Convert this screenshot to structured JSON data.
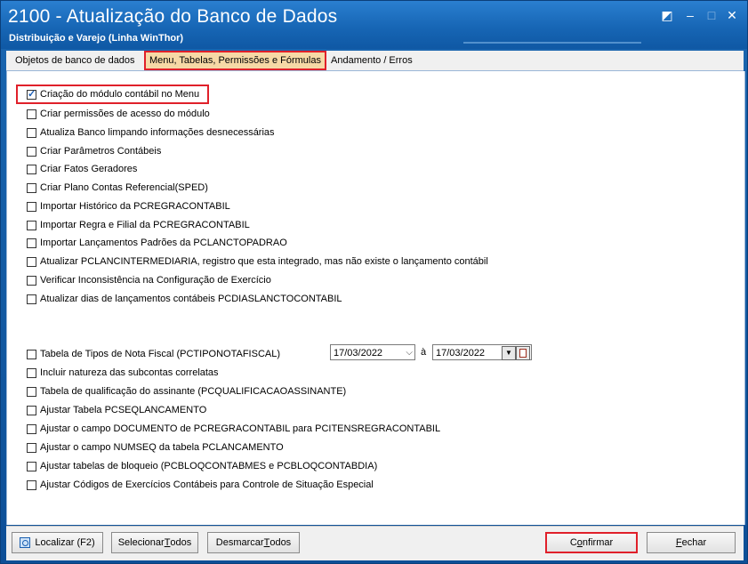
{
  "window": {
    "title": "2100 - Atualização do Banco de Dados",
    "subtitle": "Distribuição e Varejo (Linha WinThor)"
  },
  "tabs": [
    {
      "label": "Objetos de banco de dados"
    },
    {
      "label": "Menu, Tabelas, Permissões e Fórmulas"
    },
    {
      "label": "Andamento / Erros"
    }
  ],
  "options_top": [
    {
      "label": "Criação do módulo contábil no Menu",
      "checked": true
    },
    {
      "label": "Criar permissões de acesso do módulo",
      "checked": false
    },
    {
      "label": "Atualiza Banco limpando informações desnecessárias",
      "checked": false
    },
    {
      "label": "Criar Parâmetros Contábeis",
      "checked": false
    },
    {
      "label": "Criar Fatos Geradores",
      "checked": false
    },
    {
      "label": "Criar Plano Contas Referencial(SPED)",
      "checked": false
    },
    {
      "label": "Importar Histórico da PCREGRACONTABIL",
      "checked": false
    },
    {
      "label": "Importar Regra e Filial da PCREGRACONTABIL",
      "checked": false
    },
    {
      "label": "Importar Lançamentos Padrões da PCLANCTOPADRAO",
      "checked": false
    },
    {
      "label": "Atualizar PCLANCINTERMEDIARIA, registro que esta integrado, mas não existe o lançamento contábil",
      "checked": false
    },
    {
      "label": "Verificar Inconsistência na Configuração de Exercício",
      "checked": false
    },
    {
      "label": "Atualizar dias de lançamentos contábeis PCDIASLANCTOCONTABIL",
      "checked": false
    }
  ],
  "options_bottom": [
    {
      "label": "Tabela de Tipos de Nota Fiscal (PCTIPONOTAFISCAL)",
      "checked": false
    },
    {
      "label": "Incluir natureza das subcontas correlatas",
      "checked": false
    },
    {
      "label": "Tabela de qualificação do assinante (PCQUALIFICACAOASSINANTE)",
      "checked": false
    },
    {
      "label": "Ajustar Tabela PCSEQLANCAMENTO",
      "checked": false
    },
    {
      "label": "Ajustar o campo DOCUMENTO de PCREGRACONTABIL para PCITENSREGRACONTABIL",
      "checked": false
    },
    {
      "label": "Ajustar o campo NUMSEQ da tabela PCLANCAMENTO",
      "checked": false
    },
    {
      "label": "Ajustar tabelas de bloqueio (PCBLOQCONTABMES e PCBLOQCONTABDIA)",
      "checked": false
    },
    {
      "label": "Ajustar Códigos de Exercícios Contábeis para Controle de Situação Especial",
      "checked": false
    }
  ],
  "date_range": {
    "start": "17/03/2022",
    "separator": "à",
    "end": "17/03/2022"
  },
  "footer": {
    "localizar": "Localizar (F2)",
    "selecionar_prefix": "Selecionar ",
    "selecionar_ul": "T",
    "selecionar_suffix": "odos",
    "desmarcar_prefix": "Desmarcar ",
    "desmarcar_ul": "T",
    "desmarcar_suffix": "odos",
    "confirmar_prefix": "C",
    "confirmar_ul": "o",
    "confirmar_suffix": "nfirmar",
    "fechar_ul": "F",
    "fechar_suffix": "echar"
  },
  "colors": {
    "title_bar": "#1766b5",
    "highlight": "#e0202a",
    "active_tab": "#f6d9a6"
  }
}
